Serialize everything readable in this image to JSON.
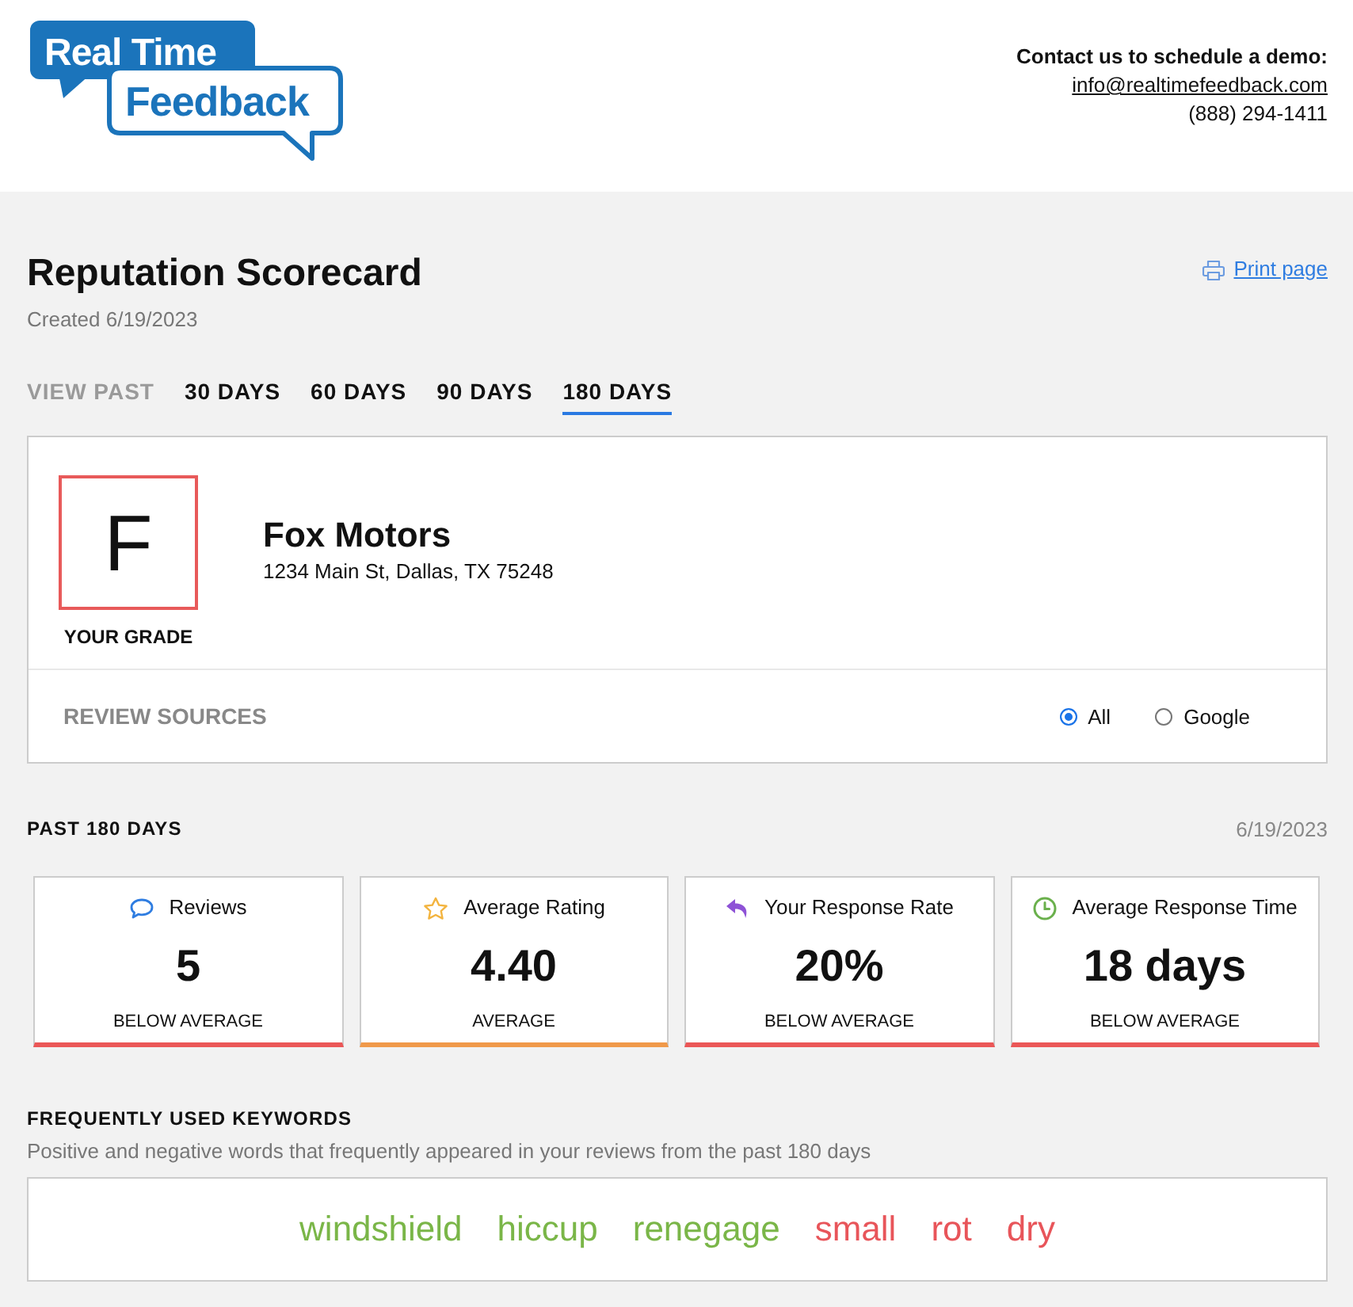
{
  "header": {
    "logo": {
      "line_1": "Real Time",
      "line_2": "Feedback"
    },
    "contact": {
      "heading": "Contact us to schedule a demo:",
      "email": "info@realtimefeedback.com",
      "phone": "(888) 294-1411"
    }
  },
  "page": {
    "title": "Reputation Scorecard",
    "created": "Created 6/19/2023",
    "print_link": "Print page"
  },
  "period_tabs": {
    "label": "VIEW PAST",
    "tabs": [
      {
        "label": "30 DAYS",
        "selected": false
      },
      {
        "label": "60 DAYS",
        "selected": false
      },
      {
        "label": "90 DAYS",
        "selected": false
      },
      {
        "label": "180 DAYS",
        "selected": true
      }
    ]
  },
  "business_card": {
    "grade": "F",
    "grade_label": "YOUR GRADE",
    "name": "Fox Motors",
    "address": "1234 Main St, Dallas, TX 75248",
    "review_sources": {
      "label": "REVIEW SOURCES",
      "options": [
        {
          "label": "All",
          "selected": true
        },
        {
          "label": "Google",
          "selected": false
        }
      ]
    }
  },
  "summary": {
    "title": "PAST 180 DAYS",
    "date": "6/19/2023",
    "metrics": [
      {
        "kind": "reviews",
        "label": "Reviews",
        "value": "5",
        "status": "BELOW AVERAGE",
        "color": "#eb5757"
      },
      {
        "kind": "rating",
        "label": "Average Rating",
        "value": "4.40",
        "status": "AVERAGE",
        "color": "#f0994a"
      },
      {
        "kind": "response_rate",
        "label": "Your Response Rate",
        "value": "20%",
        "status": "BELOW AVERAGE",
        "color": "#eb5757"
      },
      {
        "kind": "response_time",
        "label": "Average Response Time",
        "value": "18 days",
        "status": "BELOW AVERAGE",
        "color": "#eb5757"
      }
    ]
  },
  "keywords": {
    "title": "FREQUENTLY USED KEYWORDS",
    "description": "Positive and negative words that frequently appeared in your reviews from the past 180 days",
    "words": [
      {
        "text": "windshield",
        "color": "#7ab648"
      },
      {
        "text": "hiccup",
        "color": "#7ab648"
      },
      {
        "text": "renegage",
        "color": "#7ab648"
      },
      {
        "text": "small",
        "color": "#e8555a"
      },
      {
        "text": "rot",
        "color": "#e8555a"
      },
      {
        "text": "dry",
        "color": "#e8555a"
      }
    ]
  }
}
